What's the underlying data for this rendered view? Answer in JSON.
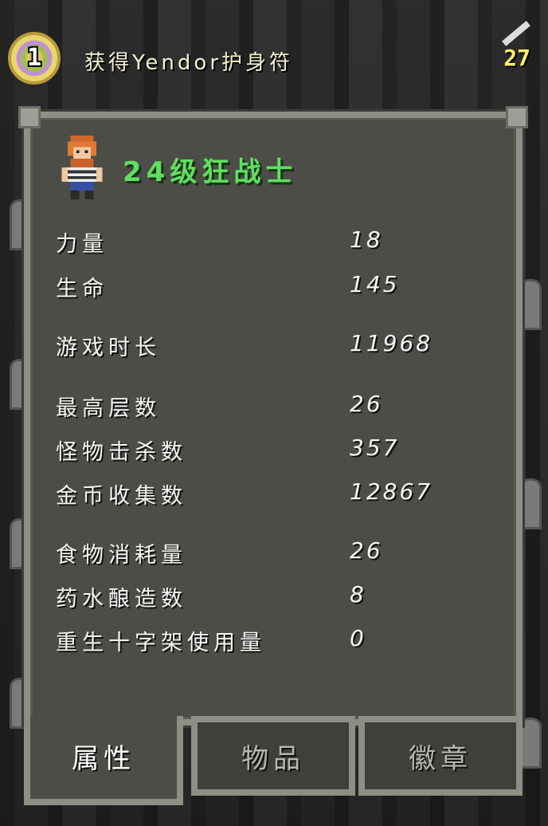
{
  "top": {
    "amulet_level": "1",
    "title": "获得Yendor护身符",
    "count": "27"
  },
  "hero": {
    "title": "24级狂战士"
  },
  "stats": [
    {
      "label": "力量",
      "value": "18"
    },
    {
      "label": "生命",
      "value": "145"
    },
    {
      "label": "游戏时长",
      "value": "11968"
    },
    {
      "label": "最高层数",
      "value": "26"
    },
    {
      "label": "怪物击杀数",
      "value": "357"
    },
    {
      "label": "金币收集数",
      "value": "12867"
    },
    {
      "label": "食物消耗量",
      "value": "26"
    },
    {
      "label": "药水酿造数",
      "value": "8"
    },
    {
      "label": "重生十字架使用量",
      "value": "0"
    }
  ],
  "tabs": [
    {
      "label": "属性",
      "active": true
    },
    {
      "label": "物品",
      "active": false
    },
    {
      "label": "徽章",
      "active": false
    }
  ],
  "colors": {
    "accent_green": "#60e060",
    "window_bg": "#4d4d48",
    "window_border": "#8e8e86",
    "gold": "#ffef6a"
  },
  "icons": [
    "amulet-icon",
    "wand-icon",
    "berserker-hero-icon"
  ]
}
